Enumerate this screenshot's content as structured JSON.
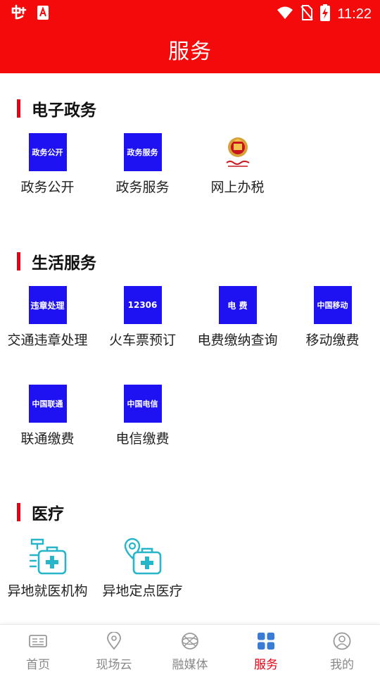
{
  "status_bar": {
    "time": "11:22"
  },
  "header": {
    "title": "服务"
  },
  "sections": [
    {
      "title": "电子政务",
      "items": [
        {
          "label": "政务公开",
          "icon_text": "政务公开",
          "icon": "blue-tile"
        },
        {
          "label": "政务服务",
          "icon_text": "政务服务",
          "icon": "blue-tile"
        },
        {
          "label": "网上办税",
          "icon": "tax-emblem-icon"
        }
      ]
    },
    {
      "title": "生活服务",
      "items": [
        {
          "label": "交通违章处理",
          "icon_text": "违章处理",
          "icon": "blue-tile"
        },
        {
          "label": "火车票预订",
          "icon_text": "12306",
          "icon": "blue-tile"
        },
        {
          "label": "电费缴纳查询",
          "icon_text": "电 费",
          "icon": "blue-tile"
        },
        {
          "label": "移动缴费",
          "icon_text": "中国移动",
          "icon": "blue-tile"
        },
        {
          "label": "联通缴费",
          "icon_text": "中国联通",
          "icon": "blue-tile"
        },
        {
          "label": "电信缴费",
          "icon_text": "中国电信",
          "icon": "blue-tile"
        }
      ]
    },
    {
      "title": "医疗",
      "items": [
        {
          "label": "异地就医机构",
          "icon": "medical-kit-icon"
        },
        {
          "label": "异地定点医疗",
          "icon": "medical-kit-location-icon"
        }
      ]
    }
  ],
  "tab_bar": {
    "items": [
      {
        "label": "首页",
        "icon": "news-icon",
        "active": false
      },
      {
        "label": "现场云",
        "icon": "location-pin-icon",
        "active": false
      },
      {
        "label": "融媒体",
        "icon": "globe-icon",
        "active": false
      },
      {
        "label": "服务",
        "icon": "grid-icon",
        "active": true
      },
      {
        "label": "我的",
        "icon": "user-icon",
        "active": false
      }
    ]
  },
  "colors": {
    "brand_red": "#f40a0a",
    "section_marker": "#e60012",
    "tile_blue": "#1e12f2",
    "medical_cyan": "#27b5c9",
    "active_tab": "#e60012",
    "inactive_tab": "#888888"
  }
}
